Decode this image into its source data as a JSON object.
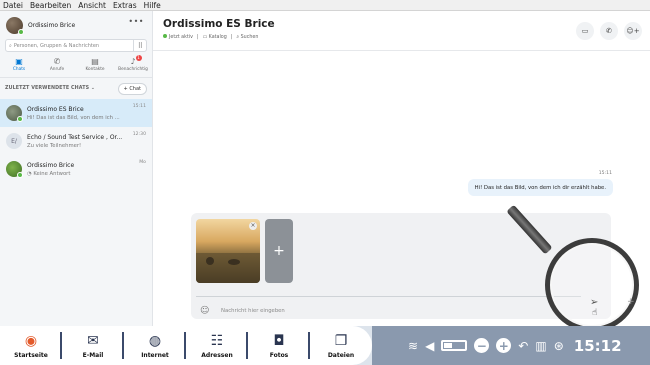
{
  "menubar": {
    "items": [
      "Datei",
      "Bearbeiten",
      "Ansicht",
      "Extras",
      "Hilfe"
    ]
  },
  "sidebar": {
    "profile_name": "Ordissimo Brice",
    "search_placeholder": "Personen, Gruppen & Nachrichten",
    "nav": [
      {
        "label": "Chats",
        "icon": "chat-icon"
      },
      {
        "label": "Anrufe",
        "icon": "phone-icon"
      },
      {
        "label": "Kontakte",
        "icon": "contacts-icon"
      },
      {
        "label": "Benachrichtig",
        "icon": "bell-icon",
        "badge": "1"
      }
    ],
    "recent_label": "ZULETZT VERWENDETE CHATS",
    "new_chat_label": "Chat",
    "chats": [
      {
        "title": "Ordissimo ES Brice",
        "subtitle": "Hi! Das ist das Bild, von dem ich ...",
        "time": "15:11",
        "selected": true
      },
      {
        "title": "Echo / Sound Test Service , Or...",
        "subtitle": "Zu viele Teilnehmer!",
        "time": "12:30",
        "avatar_text": "E/"
      },
      {
        "title": "Ordissimo Brice",
        "subtitle": "Keine Antwort",
        "time": "Mo"
      }
    ]
  },
  "conversation": {
    "title": "Ordissimo ES Brice",
    "status": "Jetzt aktiv",
    "gallery": "Katalog",
    "search": "Suchen",
    "message_time": "15:11",
    "message": "Hi! Das ist das Bild, von dem ich dir erzählt habe.",
    "input_placeholder": "Nachricht hier eingeben"
  },
  "taskbar": {
    "items": [
      {
        "label": "Startseite",
        "icon": "home-icon"
      },
      {
        "label": "E-Mail",
        "icon": "mail-icon"
      },
      {
        "label": "Internet",
        "icon": "globe-icon"
      },
      {
        "label": "Adressen",
        "icon": "contacts-icon"
      },
      {
        "label": "Fotos",
        "icon": "camera-icon"
      },
      {
        "label": "Dateien",
        "icon": "files-icon"
      }
    ],
    "clock": "15:12"
  },
  "colors": {
    "accent": "#0078d4",
    "selected_chat": "#d7ebf9",
    "tray": "#8a99ae",
    "online": "#58b947"
  }
}
